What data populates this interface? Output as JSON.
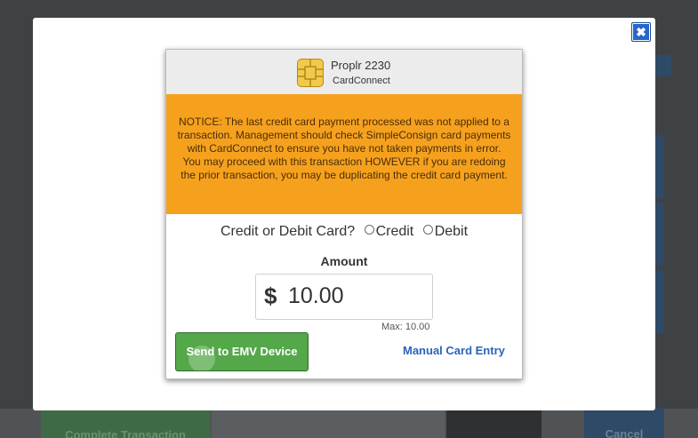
{
  "background": {
    "complete_label": "Complete Transaction",
    "cancel_label": "Cancel"
  },
  "modal": {
    "close_icon": "close-icon",
    "close_glyph": "✖",
    "terminal_name": "Proplr 2230",
    "processor_name": "CardConnect",
    "notice_text": "NOTICE: The last credit card payment processed was not applied to a transaction. Management should check SimpleConsign card payments with CardConnect to ensure you have not taken payments in error. You may proceed with this transaction HOWEVER if you are redoing the prior transaction, you may be duplicating the credit card payment.",
    "card_type_question": "Credit or Debit Card?",
    "option_credit": "Credit",
    "option_debit": "Debit",
    "amount_label": "Amount",
    "currency_symbol": "$",
    "amount_value": "10.00",
    "max_label": "Max: 10.00",
    "send_button_label": "Send to EMV Device",
    "manual_entry_label": "Manual Card Entry"
  },
  "colors": {
    "notice_bg": "#f6a11e",
    "send_button_bg": "#55a84a",
    "link": "#2a64b8",
    "close_button": "#2767c9"
  }
}
